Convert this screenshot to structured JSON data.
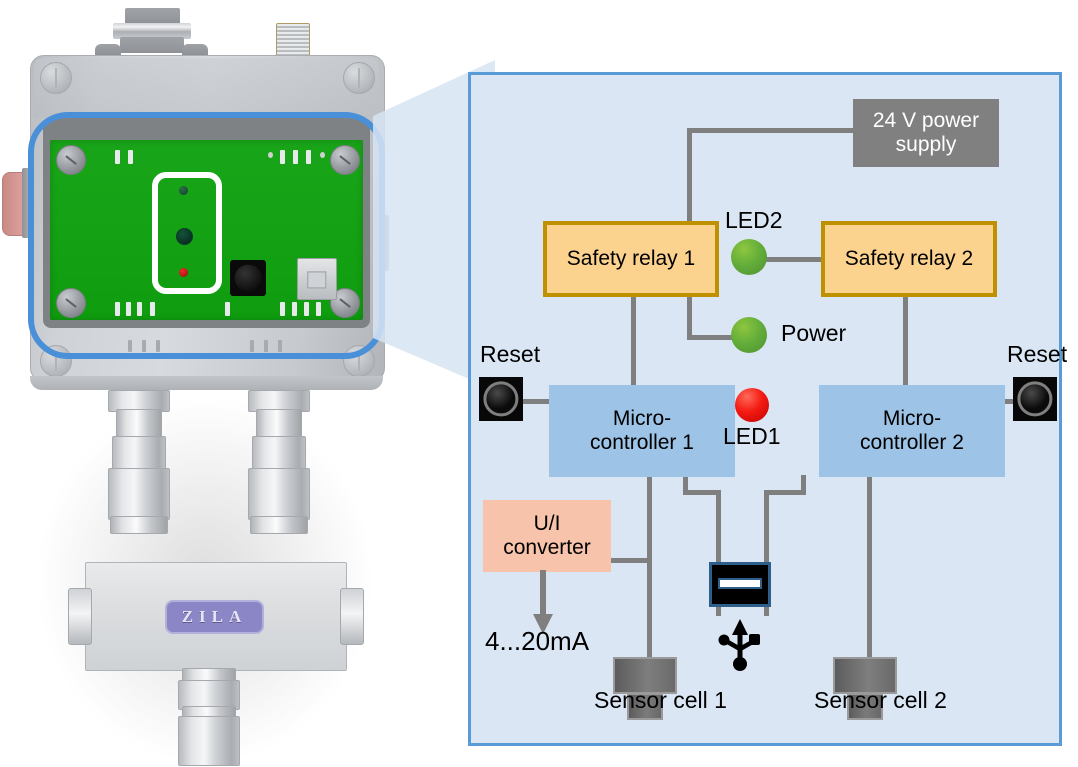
{
  "photo": {
    "brand_label": "ZILA",
    "highlight_color": "#4a90d9",
    "pcb_color": "#12a112",
    "leds": [
      {
        "name": "led-green-small",
        "color": "#2e6b4a"
      },
      {
        "name": "led-green-large",
        "color": "#14543a"
      },
      {
        "name": "led-red-small",
        "color": "#ee2b2b"
      }
    ]
  },
  "diagram": {
    "panel_bg": "#dbe6f5",
    "panel_border": "#5b9bd5",
    "wire_color": "#7f7f7f",
    "nodes": {
      "psu": {
        "label": "24 V power supply",
        "fill": "#808080",
        "text": "#ffffff"
      },
      "relay1": {
        "label": "Safety relay 1",
        "fill": "#fbd38f",
        "border": "#bf9000"
      },
      "relay2": {
        "label": "Safety relay 2",
        "fill": "#fbd38f",
        "border": "#bf9000"
      },
      "mcu1": {
        "label": "Micro-\ncontroller 1",
        "line1": "Micro-",
        "line2": "controller 1",
        "fill": "#9dc3e6"
      },
      "mcu2": {
        "label": "Micro-\ncontroller 2",
        "line1": "Micro-",
        "line2": "controller 2",
        "fill": "#9dc3e6"
      },
      "converter": {
        "line1": "U/I",
        "line2": "converter",
        "fill": "#f8c3ab"
      }
    },
    "labels": {
      "led2": "LED2",
      "power": "Power",
      "led1": "LED1",
      "reset_left": "Reset",
      "reset_right": "Reset",
      "output_current": "4...20mA",
      "sensor1": "Sensor cell 1",
      "sensor2": "Sensor cell 2"
    },
    "indicators": {
      "led2": {
        "name": "led2-green",
        "color": "#63ad3a",
        "state": "green"
      },
      "power": {
        "name": "power-led-green",
        "color": "#63ad3a",
        "state": "green"
      },
      "led1": {
        "name": "led1-red",
        "color": "#f41b13",
        "state": "red"
      }
    },
    "icons": {
      "reset_left": "reset-button-icon",
      "reset_right": "reset-button-icon",
      "usb_port": "usb-port-icon",
      "usb_symbol": "usb-trident-icon",
      "sensor1": "sensor-cell-icon",
      "sensor2": "sensor-cell-icon"
    }
  }
}
